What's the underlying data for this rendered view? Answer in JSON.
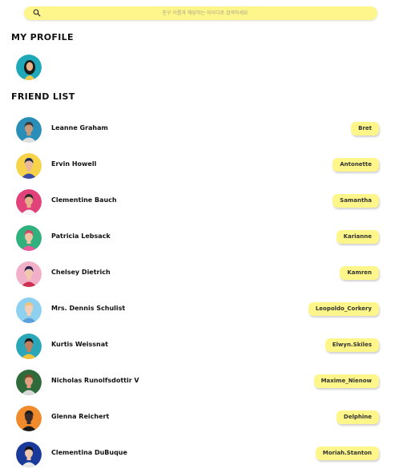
{
  "search": {
    "placeholder": "친구 이름과 해당하는 아이디로 검색하세요",
    "icon": "search-icon"
  },
  "my_profile": {
    "title": "MY PROFILE"
  },
  "friend_list": {
    "title": "FRIEND LIST",
    "friends": [
      {
        "name": "Leanne Graham",
        "username": "Bret",
        "avatar_bg": "#2a8fb8",
        "hair": "#3a3a3a",
        "skin": "#c99a7a",
        "shirt": "#e0e0e0"
      },
      {
        "name": "Ervin Howell",
        "username": "Antonette",
        "avatar_bg": "#f7d34a",
        "hair": "#1d2a5a",
        "skin": "#e9b99a",
        "shirt": "#3a4aa8"
      },
      {
        "name": "Clementine Bauch",
        "username": "Samantha",
        "avatar_bg": "#e2427a",
        "hair": "#2a2a2a",
        "skin": "#e8b08a",
        "shirt": "#f4f4f4"
      },
      {
        "name": "Patricia Lebsack",
        "username": "Karianne",
        "avatar_bg": "#2fb07c",
        "hair": "#d24a6a",
        "skin": "#f0c4a4",
        "shirt": "#e85a9a"
      },
      {
        "name": "Chelsey Dietrich",
        "username": "Kamren",
        "avatar_bg": "#f2b0c8",
        "hair": "#2a2050",
        "skin": "#f0c8b0",
        "shirt": "#d03050"
      },
      {
        "name": "Mrs. Dennis Schulist",
        "username": "Leopoldo_Corkery",
        "avatar_bg": "#8ed0f0",
        "hair": "#f2c27a",
        "skin": "#f3cfb8",
        "shirt": "#5aa0d8"
      },
      {
        "name": "Kurtis Weissnat",
        "username": "Elwyn.Skiles",
        "avatar_bg": "#2aa6b8",
        "hair": "#1a1a1a",
        "skin": "#c08060",
        "shirt": "#f2c23a"
      },
      {
        "name": "Nicholas Runolfsdottir V",
        "username": "Maxime_Nienow",
        "avatar_bg": "#2f6a3a",
        "hair": "#7a4a2a",
        "skin": "#e0a080",
        "shirt": "#d8d8d8"
      },
      {
        "name": "Glenna Reichert",
        "username": "Delphine",
        "avatar_bg": "#f08a2a",
        "hair": "#1a1a1a",
        "skin": "#3a2a2a",
        "shirt": "#1a1a1a"
      },
      {
        "name": "Clementina DuBuque",
        "username": "Moriah.Stanton",
        "avatar_bg": "#1a3a9a",
        "hair": "#101010",
        "skin": "#f0c8b0",
        "shirt": "#e8e8e8"
      }
    ]
  }
}
